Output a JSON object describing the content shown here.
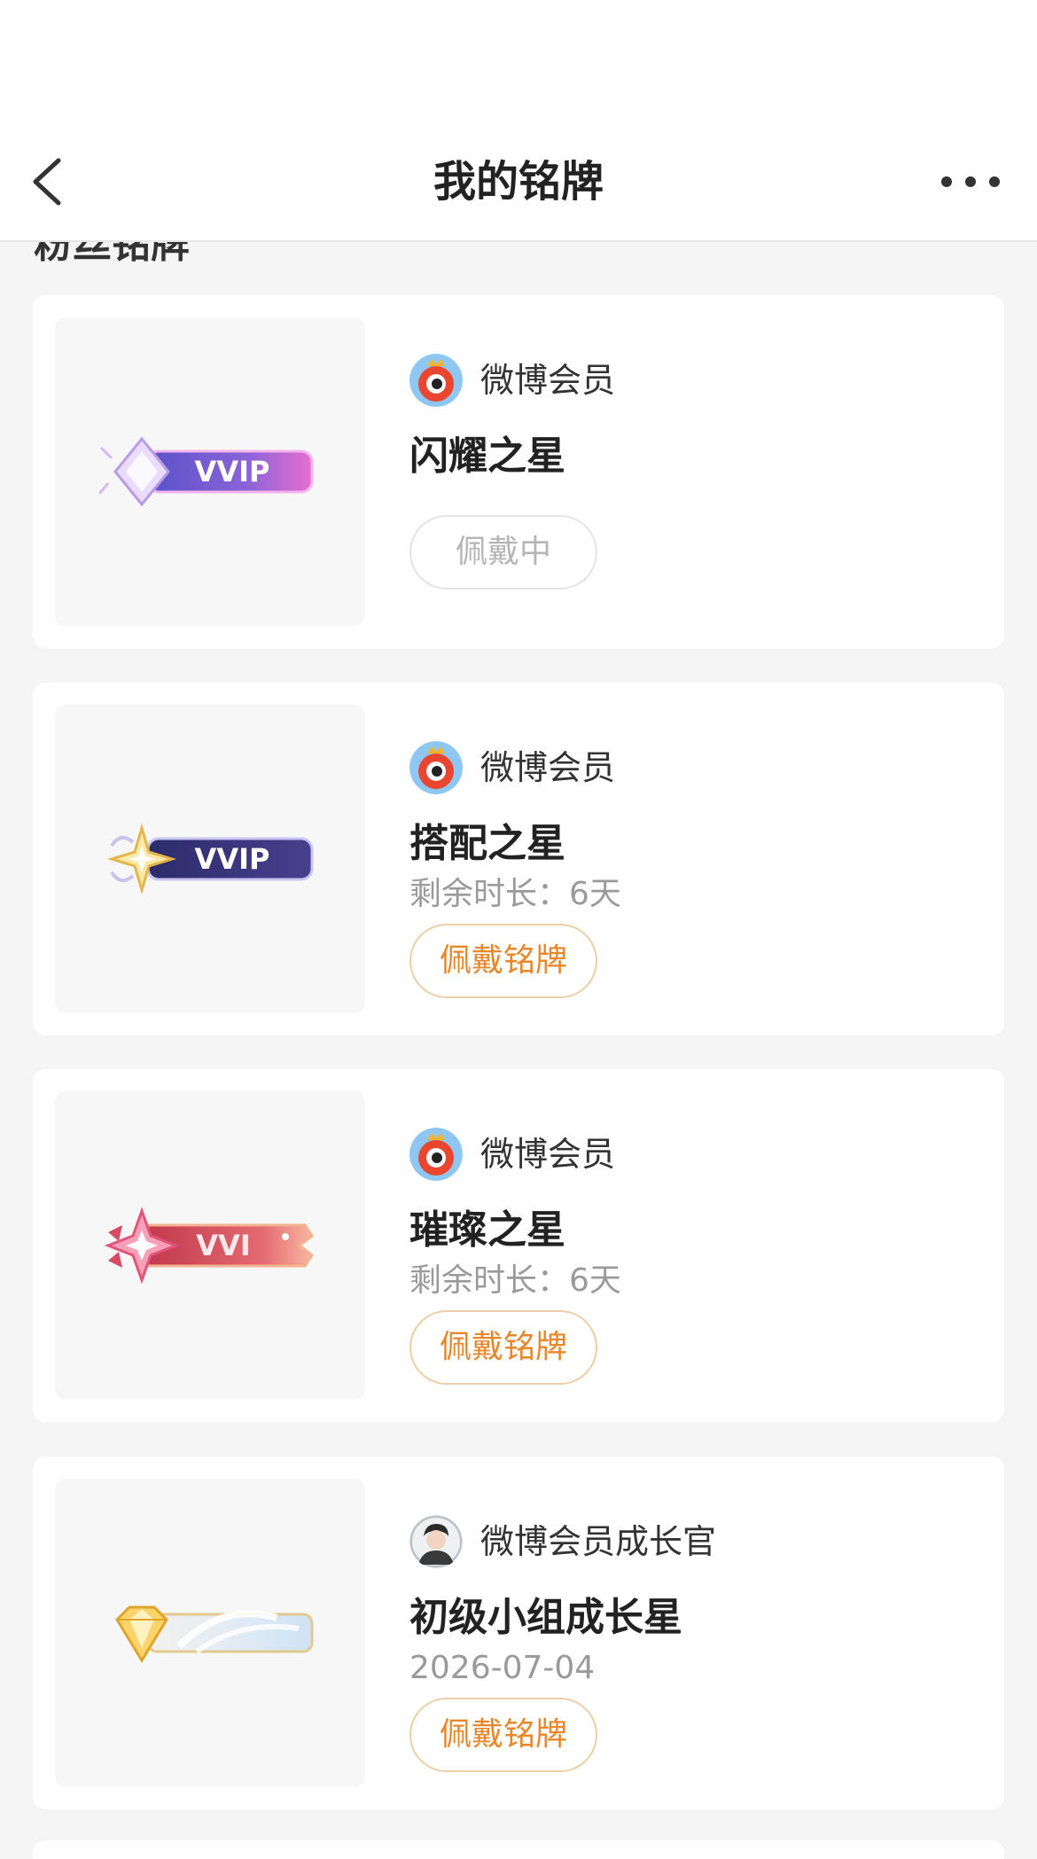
{
  "nav": {
    "title": "我的铭牌"
  },
  "section_title": "粉丝铭牌",
  "colors": {
    "accent": "#e8862a",
    "page_bg": "#f5f5f5",
    "card_bg": "#ffffff"
  },
  "cards": [
    {
      "brand": "微博会员",
      "brand_icon": "weibo-eye-mascot-icon",
      "badge_image": "vvip-badge-purple",
      "badge_text": "VVIP",
      "title": "闪耀之星",
      "sub": "",
      "button": "佩戴中"
    },
    {
      "brand": "微博会员",
      "brand_icon": "weibo-eye-mascot-icon",
      "badge_image": "vvip-badge-dark",
      "badge_text": "VVIP",
      "title": "搭配之星",
      "sub": "剩余时长：6天",
      "button": "佩戴铭牌"
    },
    {
      "brand": "微博会员",
      "brand_icon": "weibo-eye-mascot-icon",
      "badge_image": "vvip-badge-red",
      "badge_text": "VVI",
      "title": "璀璨之星",
      "sub": "剩余时长：6天",
      "button": "佩戴铭牌"
    },
    {
      "brand": "微博会员成长官",
      "brand_icon": "user-avatar-photo",
      "badge_image": "diamond-badge-gold",
      "badge_text": "",
      "title": "初级小组成长星",
      "sub": "2026-07-04",
      "button": "佩戴铭牌"
    }
  ]
}
